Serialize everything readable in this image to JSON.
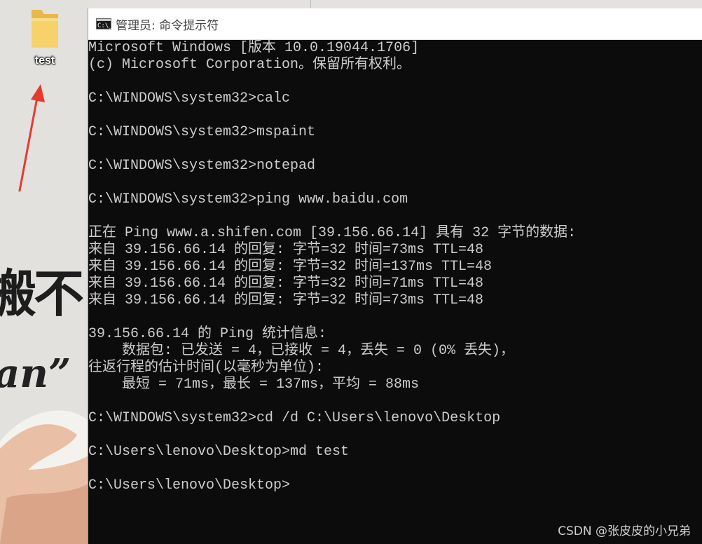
{
  "desktop": {
    "folder_label": "test",
    "wallpaper_text_1": "搬不",
    "wallpaper_text_2": "an”"
  },
  "window": {
    "title": "管理员: 命令提示符",
    "icon_text": "C:\\_"
  },
  "console": {
    "lines": [
      "Microsoft Windows [版本 10.0.19044.1706]",
      "(c) Microsoft Corporation。保留所有权利。",
      "",
      "C:\\WINDOWS\\system32>calc",
      "",
      "C:\\WINDOWS\\system32>mspaint",
      "",
      "C:\\WINDOWS\\system32>notepad",
      "",
      "C:\\WINDOWS\\system32>ping www.baidu.com",
      "",
      "正在 Ping www.a.shifen.com [39.156.66.14] 具有 32 字节的数据:",
      "来自 39.156.66.14 的回复: 字节=32 时间=73ms TTL=48",
      "来自 39.156.66.14 的回复: 字节=32 时间=137ms TTL=48",
      "来自 39.156.66.14 的回复: 字节=32 时间=71ms TTL=48",
      "来自 39.156.66.14 的回复: 字节=32 时间=73ms TTL=48",
      "",
      "39.156.66.14 的 Ping 统计信息:",
      "    数据包: 已发送 = 4，已接收 = 4，丢失 = 0 (0% 丢失)，",
      "往返行程的估计时间(以毫秒为单位):",
      "    最短 = 71ms，最长 = 137ms，平均 = 88ms",
      "",
      "C:\\WINDOWS\\system32>cd /d C:\\Users\\lenovo\\Desktop",
      "",
      "C:\\Users\\lenovo\\Desktop>md test",
      "",
      "C:\\Users\\lenovo\\Desktop>"
    ]
  },
  "watermark": "CSDN @张皮皮的小兄弟"
}
